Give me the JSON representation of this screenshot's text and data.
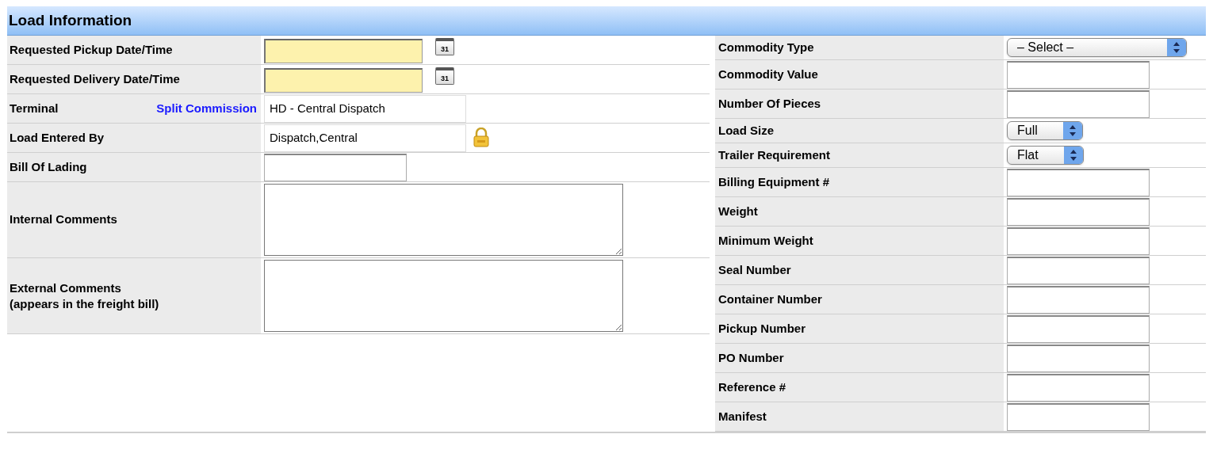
{
  "section": {
    "title": "Load Information"
  },
  "left_fields": [
    {
      "label": "Requested Pickup Date/Time",
      "kind": "date",
      "calendar": "31"
    },
    {
      "label": "Requested Delivery Date/Time",
      "kind": "date",
      "calendar": "31"
    },
    {
      "label": "Terminal",
      "link": "Split Commission",
      "kind": "text",
      "value": "HD - Central Dispatch",
      "locked": false
    },
    {
      "label": "Load Entered By",
      "kind": "text",
      "value": "Dispatch,Central",
      "locked": true
    },
    {
      "label": "Bill Of Lading",
      "kind": "short"
    },
    {
      "label": "Internal Comments",
      "kind": "textarea"
    },
    {
      "label": "External Comments",
      "note": "(appears in the freight bill)",
      "kind": "textarea"
    }
  ],
  "right_fields": [
    {
      "label": "Commodity Type",
      "kind": "select",
      "value": "– Select –"
    },
    {
      "label": "Commodity Value",
      "kind": "text"
    },
    {
      "label": "Number Of Pieces",
      "kind": "text"
    },
    {
      "label": "Load Size",
      "kind": "select",
      "value": "Full"
    },
    {
      "label": "Trailer Requirement",
      "kind": "select",
      "value": "Flat"
    },
    {
      "label": "Billing Equipment #",
      "kind": "text"
    },
    {
      "label": "Weight",
      "kind": "text"
    },
    {
      "label": "Minimum Weight",
      "kind": "text"
    },
    {
      "label": "Seal Number",
      "kind": "text"
    },
    {
      "label": "Container Number",
      "kind": "text"
    },
    {
      "label": "Pickup Number",
      "kind": "text"
    },
    {
      "label": "PO Number",
      "kind": "text"
    },
    {
      "label": "Reference #",
      "kind": "text"
    },
    {
      "label": "Manifest",
      "kind": "text"
    }
  ]
}
